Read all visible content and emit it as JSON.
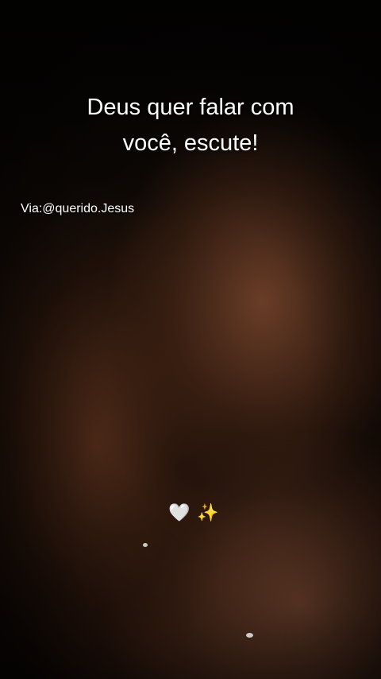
{
  "post": {
    "title_line1": "Deus quer falar com",
    "title_line2": "você, escute!",
    "credit": "Via:@querido.Jesus",
    "emoji_heart": "🤍",
    "emoji_sparkles": "✨"
  }
}
